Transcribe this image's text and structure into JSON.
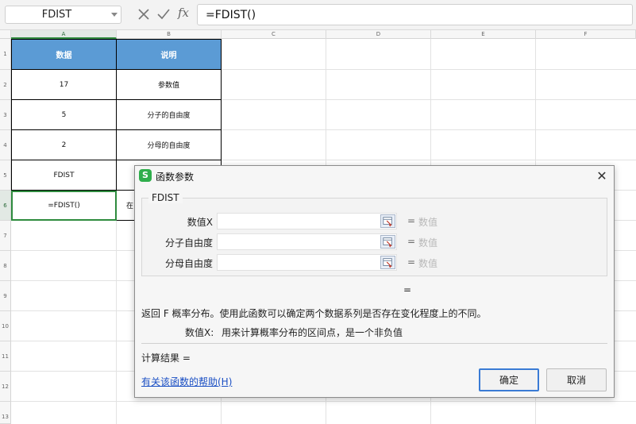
{
  "formula_bar": {
    "name_box": "FDIST",
    "cancel_icon": "close-icon",
    "enter_icon": "check-icon",
    "fx_label": "fx",
    "formula": "=FDIST()"
  },
  "sheet": {
    "columns": [
      "A",
      "B",
      "C",
      "D",
      "E",
      "F"
    ],
    "rows": [
      "1",
      "2",
      "3",
      "4",
      "5",
      "6",
      "7",
      "8",
      "9",
      "10",
      "11",
      "12",
      "13"
    ],
    "table": {
      "header": [
        "数据",
        "说明"
      ],
      "rows": [
        [
          "17",
          "参数值"
        ],
        [
          "5",
          "分子的自由度"
        ],
        [
          "2",
          "分母的自由度"
        ],
        [
          "FDIST",
          ""
        ],
        [
          "=FDIST()",
          "在"
        ]
      ]
    },
    "header_fill": "#5b9bd5",
    "selection_color": "#2e8b3e"
  },
  "dialog": {
    "title": "函数参数",
    "close_icon": "close-icon",
    "function_name": "FDIST",
    "args": [
      {
        "label": "数值X",
        "eq": "=",
        "value_hint": "数值"
      },
      {
        "label": "分子自由度",
        "eq": "=",
        "value_hint": "数值"
      },
      {
        "label": "分母自由度",
        "eq": "=",
        "value_hint": "数值"
      }
    ],
    "result_eq": "=",
    "description": "返回 F 概率分布。使用此函数可以确定两个数据系列是否存在变化程度上的不同。",
    "arg_desc_name": "数值X:",
    "arg_desc_text": "用来计算概率分布的区间点，是一个非负值",
    "calc_label": "计算结果  =",
    "help_link": "有关该函数的帮助(H)",
    "ok_label": "确定",
    "cancel_label": "取消"
  }
}
